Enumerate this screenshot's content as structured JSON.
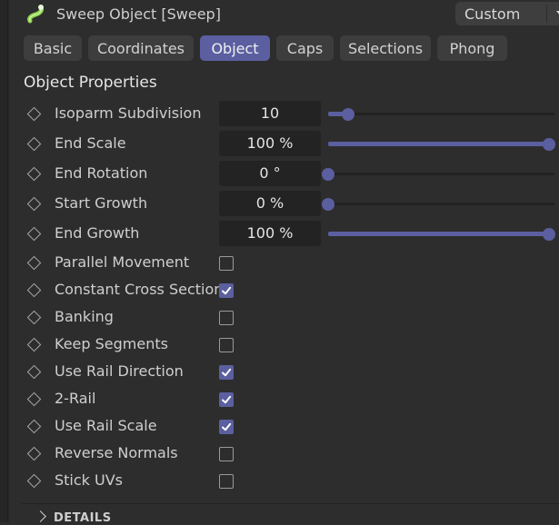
{
  "header": {
    "title": "Sweep Object [Sweep]",
    "icon": "sweep-object-icon",
    "mode_label": "Custom"
  },
  "tabs": [
    {
      "label": "Basic",
      "active": false
    },
    {
      "label": "Coordinates",
      "active": false
    },
    {
      "label": "Object",
      "active": true
    },
    {
      "label": "Caps",
      "active": false
    },
    {
      "label": "Selections",
      "active": false
    },
    {
      "label": "Phong",
      "active": false
    }
  ],
  "section": {
    "title": "Object Properties"
  },
  "sliders": [
    {
      "label": "Isoparm Subdivision",
      "value": "10",
      "fraction": 0.09
    },
    {
      "label": "End Scale",
      "value": "100 %",
      "fraction": 1.0
    },
    {
      "label": "End Rotation",
      "value": "0 °",
      "fraction": 0.0
    },
    {
      "label": "Start Growth",
      "value": "0 %",
      "fraction": 0.0
    },
    {
      "label": "End Growth",
      "value": "100 %",
      "fraction": 1.0
    }
  ],
  "checkboxes": [
    {
      "label": "Parallel Movement",
      "checked": false
    },
    {
      "label": "Constant Cross Section",
      "checked": true
    },
    {
      "label": "Banking",
      "checked": false
    },
    {
      "label": "Keep Segments",
      "checked": false
    },
    {
      "label": "Use Rail Direction",
      "checked": true
    },
    {
      "label": "2-Rail",
      "checked": true
    },
    {
      "label": "Use Rail Scale",
      "checked": true
    },
    {
      "label": "Reverse Normals",
      "checked": false
    },
    {
      "label": "Stick UVs",
      "checked": false
    }
  ],
  "details": {
    "label": "DETAILS"
  },
  "colors": {
    "accent": "#5b5fa0",
    "background": "#2d2d2d",
    "field": "#232323"
  }
}
